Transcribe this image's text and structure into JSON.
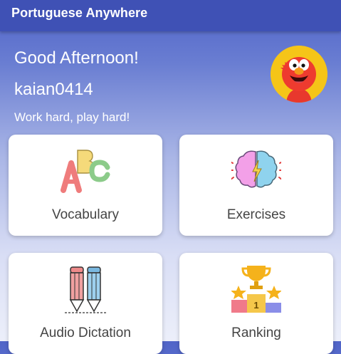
{
  "app_bar": {
    "title": "Portuguese Anywhere"
  },
  "header": {
    "greeting": "Good Afternoon!",
    "username": "kaian0414",
    "motto": "Work hard, play hard!",
    "avatar_icon": "elmo-avatar"
  },
  "menu": [
    {
      "label": "Vocabulary",
      "icon": "abc-letters-icon"
    },
    {
      "label": "Exercises",
      "icon": "brain-icon"
    },
    {
      "label": "Audio Dictation",
      "icon": "pencils-icon"
    },
    {
      "label": "Ranking",
      "icon": "trophy-podium-icon"
    }
  ],
  "colors": {
    "app_bar": "#3f51b5",
    "card_bg": "#ffffff",
    "text_dark": "#444444"
  }
}
